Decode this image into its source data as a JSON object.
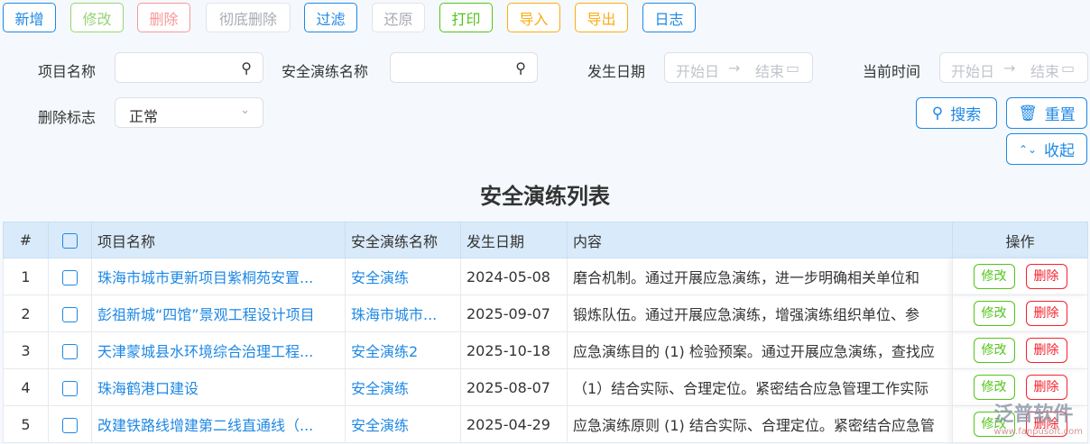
{
  "toolbar": [
    {
      "label": "新增",
      "color": "#1e88e5"
    },
    {
      "label": "修改",
      "color": "#95d475"
    },
    {
      "label": "删除",
      "color": "#f89898"
    },
    {
      "label": "彻底删除",
      "color": "#a8abb2"
    },
    {
      "label": "过滤",
      "color": "#1e88e5"
    },
    {
      "label": "还原",
      "color": "#a8abb2"
    },
    {
      "label": "打印",
      "color": "#52c41a"
    },
    {
      "label": "导入",
      "color": "#faad14"
    },
    {
      "label": "导出",
      "color": "#faad14"
    },
    {
      "label": "日志",
      "color": "#1e88e5"
    }
  ],
  "filters": {
    "project_name_label": "项目名称",
    "project_name_value": "",
    "drill_name_label": "安全演练名称",
    "drill_name_value": "",
    "date_label": "发生日期",
    "current_time_label": "当前时间",
    "start_placeholder": "开始日期",
    "end_placeholder": "结束日期",
    "arrow": "→",
    "delete_flag_label": "删除标志",
    "delete_flag_value": "正常",
    "search": "搜索",
    "reset": "重置",
    "collapse": "收起"
  },
  "table": {
    "title": "安全演练列表",
    "headers": [
      "#",
      "",
      "项目名称",
      "安全演练名称",
      "发生日期",
      "内容",
      "操作"
    ],
    "edit_label": "修改",
    "delete_label": "删除",
    "rows": [
      {
        "no": "1",
        "project": "珠海市城市更新项目紫桐苑安置...",
        "drill": "安全演练",
        "date": "2024-05-08",
        "content": "磨合机制。通过开展应急演练，进一步明确相关单位和"
      },
      {
        "no": "2",
        "project": "彭祖新城“四馆”景观工程设计项目",
        "drill": "珠海市城市...",
        "date": "2025-09-07",
        "content": "锻炼队伍。通过开展应急演练，增强演练组织单位、参"
      },
      {
        "no": "3",
        "project": "天津蒙城县水环境综合治理工程...",
        "drill": "安全演练2",
        "date": "2025-10-18",
        "content": "应急演练目的 (1) 检验预案。通过开展应急演练，查找应"
      },
      {
        "no": "4",
        "project": "珠海鹤港口建设",
        "drill": "安全演练",
        "date": "2025-08-07",
        "content": "（1）结合实际、合理定位。紧密结合应急管理工作实际"
      },
      {
        "no": "5",
        "project": "改建铁路线增建第二线直通线（...",
        "drill": "安全演练",
        "date": "2025-04-29",
        "content": "应急演练原则 (1) 结合实际、合理定位。紧密结合应急管"
      }
    ]
  },
  "watermark": {
    "text": "泛普软件",
    "url": "www.fanpusoft.com"
  }
}
